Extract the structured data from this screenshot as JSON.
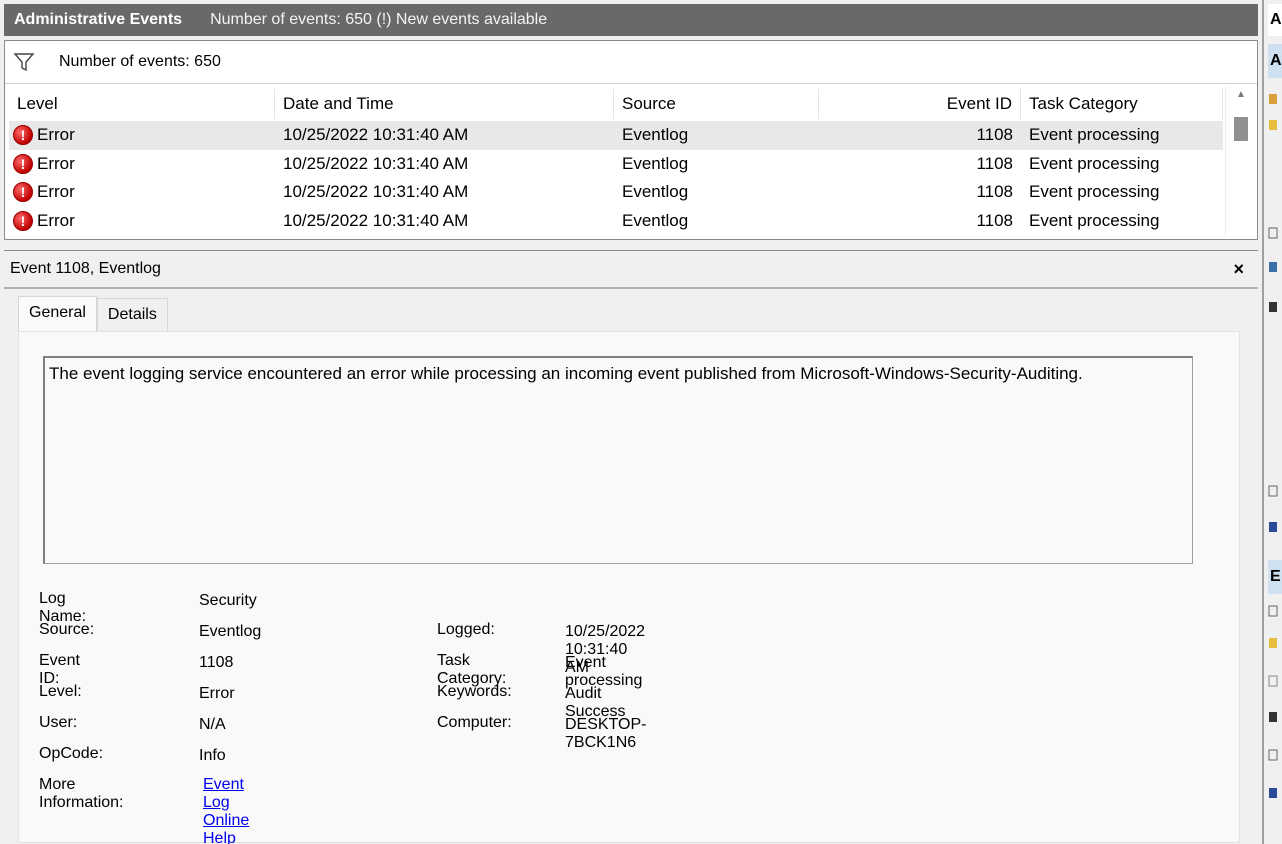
{
  "titlebar": {
    "title": "Administrative Events",
    "subtitle": "Number of events: 650 (!) New events available"
  },
  "filterbar": {
    "label": "Number of events: 650"
  },
  "grid": {
    "columns": [
      "Level",
      "Date and Time",
      "Source",
      "Event ID",
      "Task Category"
    ],
    "rows": [
      {
        "level": "Error",
        "datetime": "10/25/2022 10:31:40 AM",
        "source": "Eventlog",
        "event_id": "1108",
        "task_category": "Event processing"
      },
      {
        "level": "Error",
        "datetime": "10/25/2022 10:31:40 AM",
        "source": "Eventlog",
        "event_id": "1108",
        "task_category": "Event processing"
      },
      {
        "level": "Error",
        "datetime": "10/25/2022 10:31:40 AM",
        "source": "Eventlog",
        "event_id": "1108",
        "task_category": "Event processing"
      },
      {
        "level": "Error",
        "datetime": "10/25/2022 10:31:40 AM",
        "source": "Eventlog",
        "event_id": "1108",
        "task_category": "Event processing"
      }
    ]
  },
  "detail": {
    "header": "Event 1108, Eventlog",
    "close_glyph": "×",
    "tabs": [
      "General",
      "Details"
    ],
    "description": "The event logging service encountered an error while processing an incoming event published from Microsoft-Windows-Security-Auditing.",
    "props": {
      "log_name_label": "Log Name:",
      "log_name": "Security",
      "source_label": "Source:",
      "source": "Eventlog",
      "logged_label": "Logged:",
      "logged": "10/25/2022 10:31:40 AM",
      "event_id_label": "Event ID:",
      "event_id": "1108",
      "task_category_label": "Task Category:",
      "task_category": "Event processing",
      "level_label": "Level:",
      "level": "Error",
      "keywords_label": "Keywords:",
      "keywords": "Audit Success",
      "user_label": "User:",
      "user": "N/A",
      "computer_label": "Computer:",
      "computer": "DESKTOP-7BCK1N6",
      "opcode_label": "OpCode:",
      "opcode": "Info",
      "more_info_label": "More Information:",
      "more_info_link": "Event Log Online Help"
    }
  },
  "right_pane": {
    "header_initial": "A",
    "band1_initial": "A",
    "band2_initial": "E"
  },
  "icons": {
    "filter": "filter-icon",
    "error": "error-icon",
    "close": "close-icon"
  },
  "colors": {
    "titlebar_bg": "#696969",
    "error_red": "#c00000",
    "link_blue": "#0000ee",
    "selected_row_bg": "#e8e8e8"
  }
}
